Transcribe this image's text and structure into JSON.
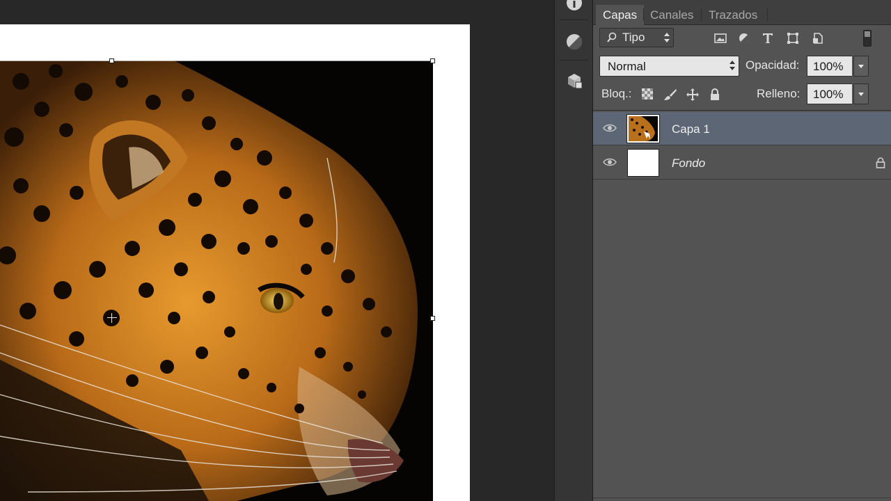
{
  "document": {
    "layer_image": "leopard-photo"
  },
  "tool_strip": {
    "buttons": [
      "info-icon",
      "adjustments-icon",
      "3d-layers-icon"
    ]
  },
  "layers_panel": {
    "tabs": [
      {
        "label": "Capas",
        "active": true
      },
      {
        "label": "Canales",
        "active": false
      },
      {
        "label": "Trazados",
        "active": false
      }
    ],
    "filter": {
      "label": "Tipo",
      "icons": [
        "image-filter-icon",
        "adjustment-filter-icon",
        "type-filter-icon",
        "shape-filter-icon",
        "smart-object-filter-icon"
      ]
    },
    "blend_mode": "Normal",
    "opacity_label": "Opacidad:",
    "opacity_value": "100%",
    "lock_label": "Bloq.:",
    "lock_icons": [
      "lock-transparency-icon",
      "lock-pixels-icon",
      "lock-position-icon",
      "lock-all-icon"
    ],
    "fill_label": "Relleno:",
    "fill_value": "100%",
    "layers": [
      {
        "name": "Capa 1",
        "selected": true,
        "visible": true,
        "locked": false
      },
      {
        "name": "Fondo",
        "selected": false,
        "visible": true,
        "locked": true
      }
    ]
  },
  "colors": {
    "panel_bg": "#535353",
    "selected_layer": "#5c6675",
    "canvas_bg": "#282828"
  }
}
